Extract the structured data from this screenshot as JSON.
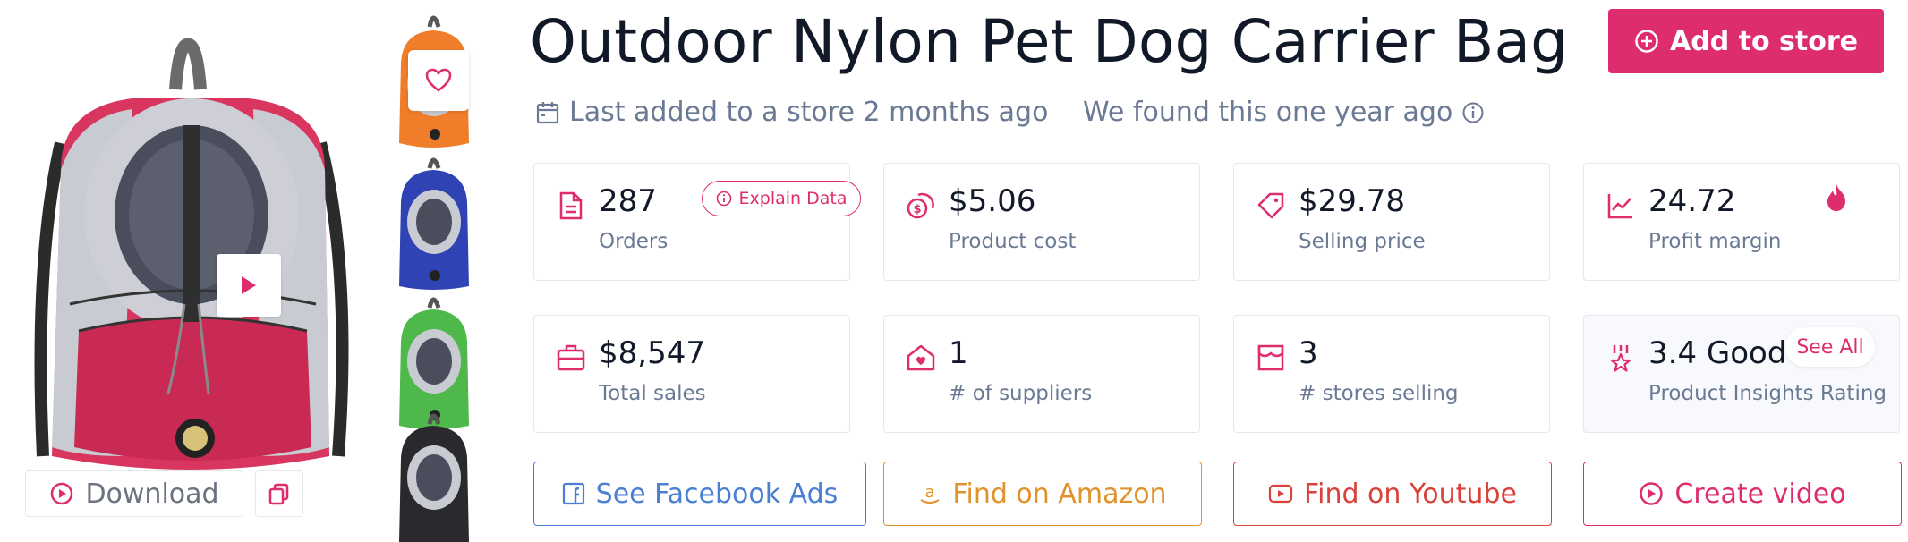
{
  "product": {
    "title": "Outdoor Nylon Pet Dog Carrier Bag",
    "add_label": "Add to store",
    "last_added": "Last added to a store 2 months ago",
    "found": "We found this one year ago"
  },
  "media": {
    "download_label": "Download",
    "thumbnails": [
      {
        "color": "orange",
        "hex": "#f07d2a"
      },
      {
        "color": "blue",
        "hex": "#2f43b5"
      },
      {
        "color": "green",
        "hex": "#4fb84a"
      },
      {
        "color": "black",
        "hex": "#2a2a2e"
      }
    ],
    "main_color": "#d8365f"
  },
  "stats": [
    {
      "value": "287",
      "label": "Orders",
      "icon": "document-icon"
    },
    {
      "value": "$5.06",
      "label": "Product cost",
      "icon": "coins-icon"
    },
    {
      "value": "$29.78",
      "label": "Selling price",
      "icon": "tag-icon"
    },
    {
      "value": "24.72",
      "label": "Profit margin",
      "icon": "trend-icon"
    },
    {
      "value": "$8,547",
      "label": "Total sales",
      "icon": "briefcase-icon"
    },
    {
      "value": "1",
      "label": "# of suppliers",
      "icon": "home-heart-icon"
    },
    {
      "value": "3",
      "label": "# stores selling",
      "icon": "store-icon"
    },
    {
      "value": "3.4 Good",
      "label": "Product Insights Rating",
      "icon": "award-icon"
    }
  ],
  "explain_label": "Explain Data",
  "see_all_label": "See All",
  "actions": {
    "facebook": "See Facebook Ads",
    "amazon": "Find on Amazon",
    "youtube": "Find on Youtube",
    "video": "Create video"
  },
  "colors": {
    "accent": "#dd2d6e",
    "facebook": "#4a7fd4",
    "amazon": "#e0932c",
    "youtube": "#d9423a",
    "muted": "#6b7a94"
  }
}
